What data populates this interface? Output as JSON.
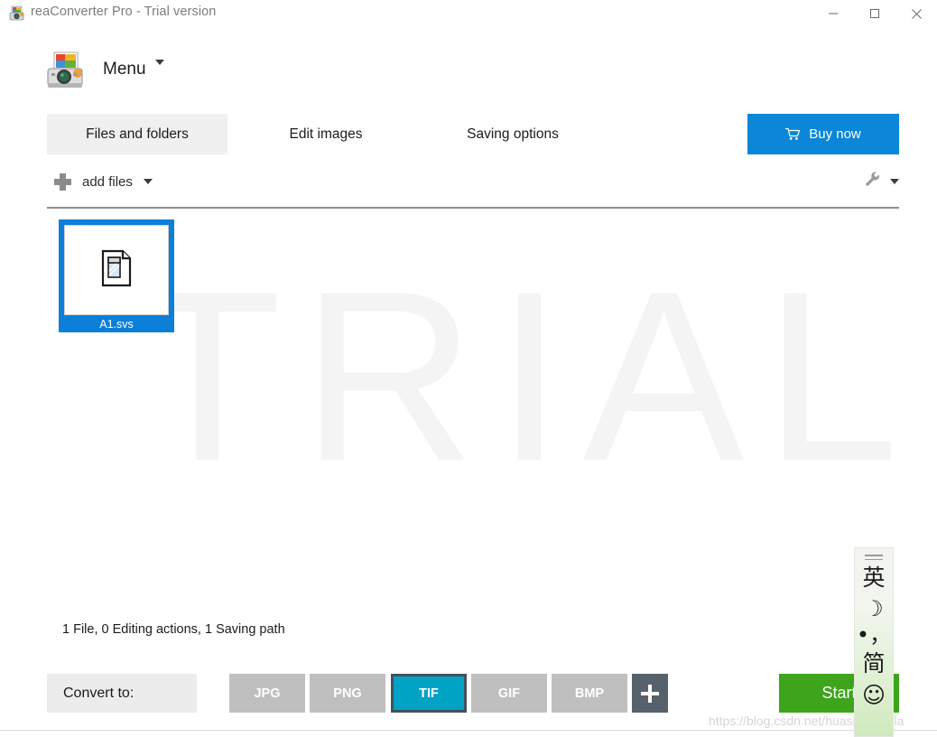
{
  "window": {
    "title": "reaConverter Pro - Trial version",
    "app_icon": "scanner-photo-icon",
    "controls": {
      "minimize": "minimize-icon",
      "maximize": "maximize-icon",
      "close": "close-icon"
    }
  },
  "menu": {
    "logo_icon": "reaconverter-logo-icon",
    "label": "Menu",
    "caret_icon": "chevron-down-icon"
  },
  "tabs": [
    {
      "label": "Files and folders",
      "active": true
    },
    {
      "label": "Edit images",
      "active": false
    },
    {
      "label": "Saving options",
      "active": false
    }
  ],
  "buy_now": {
    "label": "Buy now",
    "icon": "shopping-cart-icon",
    "color": "#0c87d8"
  },
  "toolbar": {
    "add_files_label": "add files",
    "add_files_icon": "plus-icon",
    "add_files_caret": "chevron-down-icon",
    "settings_icon": "wrench-icon",
    "settings_caret": "chevron-down-icon"
  },
  "workspace": {
    "watermark": "TRIAL",
    "files": [
      {
        "name": "A1.svs",
        "icon": "document-page-icon",
        "selected": true
      }
    ]
  },
  "status": {
    "text": "1 File, 0 Editing actions, 1 Saving path"
  },
  "bottom": {
    "convert_to_label": "Convert to:",
    "formats": [
      {
        "label": "JPG",
        "selected": false
      },
      {
        "label": "PNG",
        "selected": false
      },
      {
        "label": "TIF",
        "selected": true
      },
      {
        "label": "GIF",
        "selected": false
      },
      {
        "label": "BMP",
        "selected": false
      }
    ],
    "add_format_icon": "plus-icon",
    "start_label": "Start",
    "start_color": "#3da41b",
    "selected_format_color": "#00a3c4"
  },
  "overlay_watermark": {
    "url": "https://blog.csdn.net/huashengjdfla"
  },
  "ime_panel": {
    "handle_icon": "drag-handle-icon",
    "items": [
      {
        "label": "英",
        "name": "ime-language-mode"
      },
      {
        "label": "☽",
        "name": "ime-moon-icon"
      },
      {
        "label": "•，",
        "name": "ime-punctuation-mode"
      },
      {
        "label": "简",
        "name": "ime-simplified-chinese"
      },
      {
        "label": "☺",
        "name": "ime-smiley-icon"
      }
    ]
  }
}
